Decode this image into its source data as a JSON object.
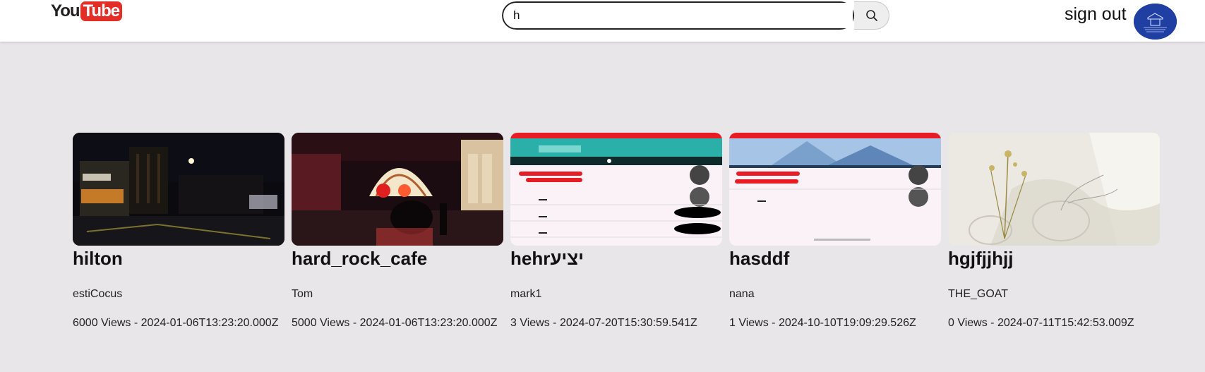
{
  "header": {
    "logo": {
      "left": "You",
      "right": "Tube"
    },
    "search": {
      "value": "h",
      "placeholder": ""
    },
    "search_button_icon": "search-icon",
    "signout_label": "sign out",
    "avatar_icon": "user-avatar"
  },
  "videos": [
    {
      "title": "hilton",
      "author": "estiCocus",
      "meta": "6000 Views - 2024-01-06T13:23:20.000Z"
    },
    {
      "title": "hard_rock_cafe",
      "author": "Tom",
      "meta": "5000 Views - 2024-01-06T13:23:20.000Z"
    },
    {
      "title": "hehrיציע",
      "author": "mark1",
      "meta": "3 Views - 2024-07-20T15:30:59.541Z"
    },
    {
      "title": "hasddf",
      "author": "nana",
      "meta": "1 Views - 2024-10-10T19:09:29.526Z"
    },
    {
      "title": "hgjfjjhjj",
      "author": "THE_GOAT",
      "meta": "0 Views - 2024-07-11T15:42:53.009Z"
    }
  ],
  "colors": {
    "background": "#e8e6e9",
    "brand_red": "#e52d27",
    "avatar_blue": "#1f3fa3"
  }
}
